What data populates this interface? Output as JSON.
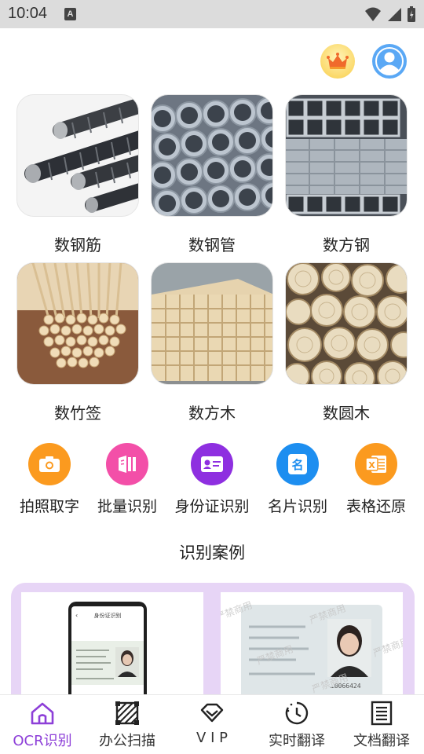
{
  "status_bar": {
    "time": "10:04",
    "indicator": "A"
  },
  "header": {
    "crown_icon": "crown-icon",
    "avatar_icon": "user-avatar-icon"
  },
  "grid": {
    "items": [
      {
        "label": "数钢筋",
        "image": "rebar-photo"
      },
      {
        "label": "数钢管",
        "image": "steel-pipe-photo"
      },
      {
        "label": "数方钢",
        "image": "square-steel-photo"
      },
      {
        "label": "数竹签",
        "image": "bamboo-sticks-photo"
      },
      {
        "label": "数方木",
        "image": "square-timber-photo"
      },
      {
        "label": "数圆木",
        "image": "round-logs-photo"
      }
    ]
  },
  "tools": {
    "items": [
      {
        "label": "拍照取字",
        "icon": "camera-icon",
        "color": "#fb9a1f"
      },
      {
        "label": "批量识别",
        "icon": "batch-pages-icon",
        "color": "#f34fa8"
      },
      {
        "label": "身份证识别",
        "icon": "id-card-icon",
        "color": "#8e2fe0"
      },
      {
        "label": "名片识别",
        "icon": "business-card-icon",
        "color": "#1d8ef0"
      },
      {
        "label": "表格还原",
        "icon": "excel-icon",
        "color": "#fb9a1f"
      }
    ]
  },
  "cases": {
    "title": "识别案例",
    "watermark": "严禁商用",
    "phone_screen_title": "身份证识别"
  },
  "bottom_nav": {
    "items": [
      {
        "label": "OCR识别",
        "icon": "home-icon",
        "active": true
      },
      {
        "label": "办公扫描",
        "icon": "scan-icon",
        "active": false
      },
      {
        "label": "V I P",
        "icon": "vip-diamond-icon",
        "active": false
      },
      {
        "label": "实时翻译",
        "icon": "clock-icon",
        "active": false
      },
      {
        "label": "文档翻译",
        "icon": "document-icon",
        "active": false
      }
    ]
  },
  "colors": {
    "accent": "#8d3fd8",
    "cases_bg": "#e7d5f6",
    "avatar": "#5aa8f5"
  }
}
